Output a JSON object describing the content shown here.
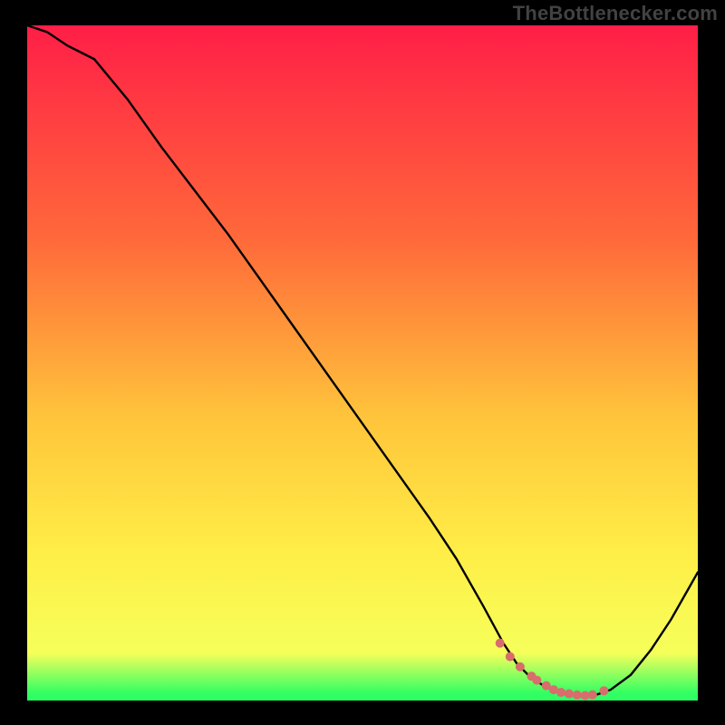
{
  "watermark": {
    "text": "TheBottlenecker.com"
  },
  "colors": {
    "black": "#000000",
    "gradient_top": "#ff1e47",
    "gradient_mid1": "#ff6a3a",
    "gradient_mid2": "#ffc43b",
    "gradient_mid3": "#ffee47",
    "gradient_midlow": "#f6ff5a",
    "gradient_green": "#2fff63",
    "curve_stroke": "#000000",
    "marker_fill": "#d96c6c"
  },
  "chart_data": {
    "type": "line",
    "title": "",
    "xlabel": "",
    "ylabel": "",
    "xlim": [
      0,
      100
    ],
    "ylim": [
      0,
      100
    ],
    "series": [
      {
        "name": "bottleneck-curve",
        "x": [
          0,
          3,
          6,
          10,
          15,
          20,
          25,
          30,
          35,
          40,
          45,
          50,
          55,
          60,
          64,
          68,
          71,
          73,
          75,
          77,
          79,
          81,
          83,
          85,
          87,
          90,
          93,
          96,
          100
        ],
        "values": [
          100,
          99,
          97,
          95,
          89,
          82,
          75.5,
          69,
          62,
          55,
          48,
          41,
          34,
          27,
          21,
          14,
          8.5,
          5.5,
          3.5,
          2.2,
          1.3,
          0.8,
          0.7,
          0.9,
          1.6,
          3.8,
          7.5,
          12,
          19
        ]
      }
    ],
    "markers": {
      "name": "optimal-region-points",
      "x": [
        70.5,
        72.0,
        73.5,
        75.2,
        76.0,
        77.4,
        78.5,
        79.6,
        80.8,
        82.0,
        83.2,
        84.3,
        86.0
      ],
      "values": [
        8.5,
        6.5,
        5.0,
        3.6,
        3.0,
        2.2,
        1.6,
        1.2,
        1.0,
        0.82,
        0.74,
        0.85,
        1.45
      ]
    },
    "grid": false,
    "legend": false
  }
}
